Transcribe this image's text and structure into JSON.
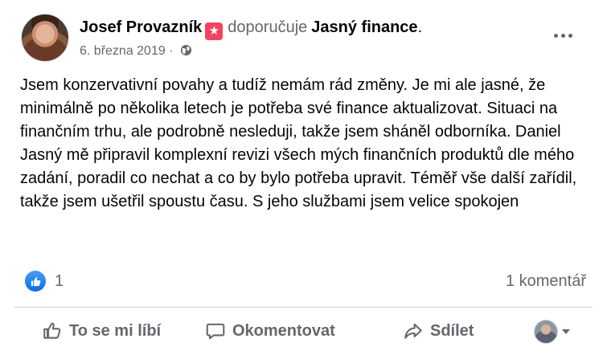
{
  "post": {
    "author": "Josef Provazník",
    "verb": "doporučuje",
    "page_name": "Jasný finance",
    "period": ".",
    "date": "6. března 2019",
    "separator": "·",
    "audience_icon": "globe-icon",
    "text": "Jsem konzervativní povahy a tudíž nemám rád změny. Je mi ale jasné, že minimálně po několika letech je potřeba své finance aktualizovat. Situaci na finančním trhu, ale podrobně nesleduji, takže jsem sháněl odborníka. Daniel Jasný mě připravil komplexní revizi všech mých finančních produktů dle mého zadání, poradil co nechat a co by bylo potřeba upravit. Téměř vše další zařídil, takže jsem ušetřil spoustu času. S jeho službami jsem velice spokojen"
  },
  "reactions": {
    "like_count": "1",
    "comment_count": "1 komentář"
  },
  "actions": {
    "like_label": "To se mi líbí",
    "comment_label": "Okomentovat",
    "share_label": "Sdílet"
  },
  "colors": {
    "recommend_badge": "#f3425f",
    "like_blue": "#0a6ce8",
    "secondary_text": "#65676b"
  }
}
